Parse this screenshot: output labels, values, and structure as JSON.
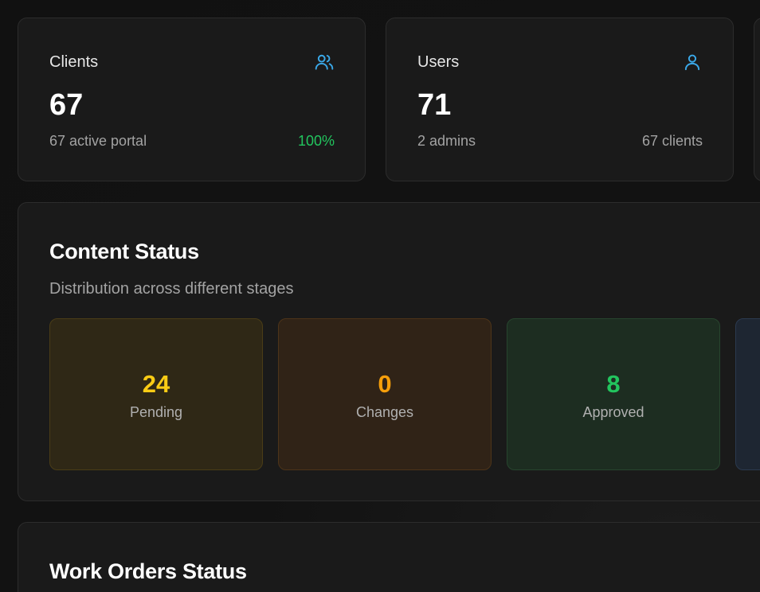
{
  "stats": {
    "clients": {
      "label": "Clients",
      "icon": "users-icon",
      "value": "67",
      "sub": "67 active portal",
      "aside": "100%",
      "aside_color": "#22c55e"
    },
    "users": {
      "label": "Users",
      "icon": "user-icon",
      "value": "71",
      "sub": "2 admins",
      "aside": "67 clients"
    }
  },
  "content_status": {
    "title": "Content Status",
    "description": "Distribution across different stages",
    "items": [
      {
        "value": "24",
        "label": "Pending",
        "color": "#facc15"
      },
      {
        "value": "0",
        "label": "Changes",
        "color": "#f59e0b"
      },
      {
        "value": "8",
        "label": "Approved",
        "color": "#22c55e"
      }
    ]
  },
  "work_orders": {
    "title": "Work Orders Status"
  },
  "theme": {
    "accent_icon": "#3aa8e8",
    "background": "#111111",
    "card": "#1a1a1a"
  }
}
